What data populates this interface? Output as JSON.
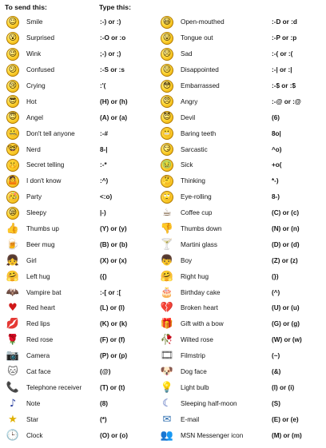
{
  "header": {
    "send": "To send this:",
    "type": "Type this:"
  },
  "rows": [
    {
      "l": {
        "name": "Smile",
        "code": ":-) or :)",
        "icon": "smile-icon",
        "glyph": "☺",
        "obj": false
      },
      "r": {
        "name": "Open-mouthed",
        "code": ":-D or :d",
        "icon": "open-mouthed-icon",
        "glyph": "😃",
        "obj": false
      }
    },
    {
      "l": {
        "name": "Surprised",
        "code": ":-O or :o",
        "icon": "surprised-icon",
        "glyph": "😮",
        "obj": false
      },
      "r": {
        "name": "Tongue out",
        "code": ":-P or :p",
        "icon": "tongue-out-icon",
        "glyph": "😛",
        "obj": false
      }
    },
    {
      "l": {
        "name": "Wink",
        "code": ";-) or ;)",
        "icon": "wink-icon",
        "glyph": "😉",
        "obj": false
      },
      "r": {
        "name": "Sad",
        "code": ":-( or :(",
        "icon": "sad-icon",
        "glyph": "☹",
        "obj": false
      }
    },
    {
      "l": {
        "name": "Confused",
        "code": ":-S or :s",
        "icon": "confused-icon",
        "glyph": "😕",
        "obj": false
      },
      "r": {
        "name": "Disappointed",
        "code": ":-| or :|",
        "icon": "disappointed-icon",
        "glyph": "😐",
        "obj": false
      }
    },
    {
      "l": {
        "name": "Crying",
        "code": ":'(",
        "icon": "crying-icon",
        "glyph": "😢",
        "obj": false
      },
      "r": {
        "name": "Embarrassed",
        "code": ":-$ or :$",
        "icon": "embarrassed-icon",
        "glyph": "😳",
        "obj": false
      }
    },
    {
      "l": {
        "name": "Hot",
        "code": "(H) or (h)",
        "icon": "hot-sunglasses-icon",
        "glyph": "😎",
        "obj": false
      },
      "r": {
        "name": "Angry",
        "code": ":-@ or :@",
        "icon": "angry-icon",
        "glyph": "😠",
        "obj": false
      }
    },
    {
      "l": {
        "name": "Angel",
        "code": "(A) or (a)",
        "icon": "angel-icon",
        "glyph": "😇",
        "obj": false
      },
      "r": {
        "name": "Devil",
        "code": "(6)",
        "icon": "devil-icon",
        "glyph": "😈",
        "obj": false
      }
    },
    {
      "l": {
        "name": "Don't tell anyone",
        "code": ":-#",
        "icon": "dont-tell-icon",
        "glyph": "🤐",
        "obj": false
      },
      "r": {
        "name": "Baring teeth",
        "code": "8o|",
        "icon": "baring-teeth-icon",
        "glyph": "😬",
        "obj": false
      }
    },
    {
      "l": {
        "name": "Nerd",
        "code": "8-|",
        "icon": "nerd-icon",
        "glyph": "🤓",
        "obj": false
      },
      "r": {
        "name": "Sarcastic",
        "code": "^o)",
        "icon": "sarcastic-icon",
        "glyph": "😏",
        "obj": false
      }
    },
    {
      "l": {
        "name": "Secret telling",
        "code": ":-*",
        "icon": "secret-telling-icon",
        "glyph": "🤫",
        "obj": false
      },
      "r": {
        "name": "Sick",
        "code": "+o(",
        "icon": "sick-icon",
        "glyph": "🤢",
        "obj": false
      }
    },
    {
      "l": {
        "name": "I don't know",
        "code": ":^)",
        "icon": "dont-know-icon",
        "glyph": "🤷",
        "obj": false
      },
      "r": {
        "name": "Thinking",
        "code": "*-)",
        "icon": "thinking-icon",
        "glyph": "🤔",
        "obj": false
      }
    },
    {
      "l": {
        "name": "Party",
        "code": "<:o)",
        "icon": "party-icon",
        "glyph": "🥳",
        "obj": false
      },
      "r": {
        "name": "Eye-rolling",
        "code": "8-)",
        "icon": "eye-rolling-icon",
        "glyph": "🙄",
        "obj": false
      }
    },
    {
      "l": {
        "name": "Sleepy",
        "code": "|-)",
        "icon": "sleepy-icon",
        "glyph": "😪",
        "obj": false
      },
      "r": {
        "name": "Coffee cup",
        "code": "(C) or (c)",
        "icon": "coffee-cup-icon",
        "glyph": "☕",
        "obj": true
      }
    },
    {
      "l": {
        "name": "Thumbs up",
        "code": "(Y) or (y)",
        "icon": "thumbs-up-icon",
        "glyph": "👍",
        "obj": true
      },
      "r": {
        "name": "Thumbs down",
        "code": "(N) or (n)",
        "icon": "thumbs-down-icon",
        "glyph": "👎",
        "obj": true
      }
    },
    {
      "l": {
        "name": "Beer mug",
        "code": "(B) or (b)",
        "icon": "beer-mug-icon",
        "glyph": "🍺",
        "obj": true
      },
      "r": {
        "name": "Martini glass",
        "code": "(D) or (d)",
        "icon": "martini-glass-icon",
        "glyph": "🍸",
        "obj": true
      }
    },
    {
      "l": {
        "name": "Girl",
        "code": "(X) or (x)",
        "icon": "girl-icon",
        "glyph": "👧",
        "obj": true
      },
      "r": {
        "name": "Boy",
        "code": "(Z) or (z)",
        "icon": "boy-icon",
        "glyph": "👦",
        "obj": true
      }
    },
    {
      "l": {
        "name": "Left hug",
        "code": "({)",
        "icon": "left-hug-icon",
        "glyph": "🤗",
        "obj": true
      },
      "r": {
        "name": "Right hug",
        "code": "(})",
        "icon": "right-hug-icon",
        "glyph": "🤗",
        "obj": true
      }
    },
    {
      "l": {
        "name": "Vampire bat",
        "code": ":-[ or :[",
        "icon": "vampire-bat-icon",
        "glyph": "🦇",
        "obj": true
      },
      "r": {
        "name": "Birthday cake",
        "code": "(^)",
        "icon": "birthday-cake-icon",
        "glyph": "🎂",
        "obj": true
      }
    },
    {
      "l": {
        "name": "Red heart",
        "code": "(L) or (l)",
        "icon": "red-heart-icon",
        "glyph": "♥",
        "obj": true
      },
      "r": {
        "name": "Broken heart",
        "code": "(U) or (u)",
        "icon": "broken-heart-icon",
        "glyph": "💔",
        "obj": true
      }
    },
    {
      "l": {
        "name": "Red lips",
        "code": "(K) or (k)",
        "icon": "red-lips-icon",
        "glyph": "💋",
        "obj": true
      },
      "r": {
        "name": "Gift with a bow",
        "code": "(G) or (g)",
        "icon": "gift-icon",
        "glyph": "🎁",
        "obj": true
      }
    },
    {
      "l": {
        "name": "Red rose",
        "code": "(F) or (f)",
        "icon": "red-rose-icon",
        "glyph": "🌹",
        "obj": true
      },
      "r": {
        "name": "Wilted rose",
        "code": "(W) or (w)",
        "icon": "wilted-rose-icon",
        "glyph": "🥀",
        "obj": true
      }
    },
    {
      "l": {
        "name": "Camera",
        "code": "(P) or (p)",
        "icon": "camera-icon",
        "glyph": "📷",
        "obj": true
      },
      "r": {
        "name": "Filmstrip",
        "code": "(~)",
        "icon": "filmstrip-icon",
        "glyph": "🎞",
        "obj": true
      }
    },
    {
      "l": {
        "name": "Cat face",
        "code": "(@)",
        "icon": "cat-face-icon",
        "glyph": "🐱",
        "obj": true
      },
      "r": {
        "name": "Dog face",
        "code": "(&)",
        "icon": "dog-face-icon",
        "glyph": "🐶",
        "obj": true
      }
    },
    {
      "l": {
        "name": "Telephone receiver",
        "code": "(T) or (t)",
        "icon": "telephone-receiver-icon",
        "glyph": "📞",
        "obj": true
      },
      "r": {
        "name": "Light bulb",
        "code": "(I) or (i)",
        "icon": "light-bulb-icon",
        "glyph": "💡",
        "obj": true
      }
    },
    {
      "l": {
        "name": "Note",
        "code": "(8)",
        "icon": "music-note-icon",
        "glyph": "♪",
        "obj": true
      },
      "r": {
        "name": "Sleeping half-moon",
        "code": "(S)",
        "icon": "half-moon-icon",
        "glyph": "☾",
        "obj": true
      }
    },
    {
      "l": {
        "name": "Star",
        "code": "(*)",
        "icon": "star-icon",
        "glyph": "★",
        "obj": true
      },
      "r": {
        "name": "E-mail",
        "code": "(E) or (e)",
        "icon": "email-icon",
        "glyph": "✉",
        "obj": true
      }
    },
    {
      "l": {
        "name": "Clock",
        "code": "(O) or (o)",
        "icon": "clock-icon",
        "glyph": "🕒",
        "obj": true
      },
      "r": {
        "name": "MSN Messenger icon",
        "code": "(M) or (m)",
        "icon": "msn-messenger-icon",
        "glyph": "👥",
        "obj": true
      }
    }
  ],
  "colors": {
    "obj_colors": {
      "coffee-cup-icon": "#6b4a2a",
      "thumbs-up-icon": "#c8902a",
      "thumbs-down-icon": "#c8902a",
      "beer-mug-icon": "#d08a10",
      "martini-glass-icon": "#c04040",
      "girl-icon": "#c05050",
      "boy-icon": "#3050a0",
      "left-hug-icon": "#3a7a30",
      "right-hug-icon": "#3a7a30",
      "vampire-bat-icon": "#333333",
      "birthday-cake-icon": "#d07aa0",
      "red-heart-icon": "#d01818",
      "broken-heart-icon": "#c01818",
      "red-lips-icon": "#d01828",
      "gift-icon": "#a03090",
      "red-rose-icon": "#c01818",
      "wilted-rose-icon": "#7a5030",
      "camera-icon": "#444444",
      "filmstrip-icon": "#555555",
      "cat-face-icon": "#666666",
      "dog-face-icon": "#8a6030",
      "telephone-receiver-icon": "#c08a10",
      "light-bulb-icon": "#d8b010",
      "music-note-icon": "#2a40a0",
      "half-moon-icon": "#3050b0",
      "star-icon": "#e0b000",
      "email-icon": "#3070b0",
      "clock-icon": "#3060a0",
      "msn-messenger-icon": "#2a8a30"
    }
  }
}
